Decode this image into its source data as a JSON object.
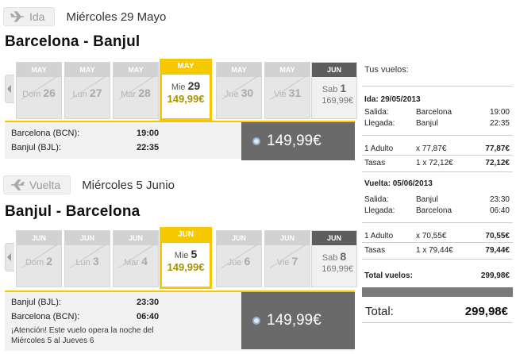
{
  "outbound": {
    "tag": "Ida",
    "date": "Miércoles 29 Mayo",
    "route": "Barcelona - Banjul",
    "days": [
      {
        "month": "MAY",
        "dow": "Dom",
        "num": "26"
      },
      {
        "month": "MAY",
        "dow": "Lun",
        "num": "27"
      },
      {
        "month": "MAY",
        "dow": "Mar",
        "num": "28"
      },
      {
        "month": "MAY",
        "dow": "Mie",
        "num": "29",
        "price": "149,99€"
      },
      {
        "month": "MAY",
        "dow": "Jue",
        "num": "30"
      },
      {
        "month": "MAY",
        "dow": "Vie",
        "num": "31"
      },
      {
        "month": "JUN",
        "dow": "Sab",
        "num": "1",
        "price": "169,99€"
      }
    ],
    "from": "Barcelona (BCN):",
    "from_time": "19:00",
    "to": "Banjul (BJL):",
    "to_time": "22:35",
    "price": "149,99€"
  },
  "return": {
    "tag": "Vuelta",
    "date": "Miércoles 5 Junio",
    "route": "Banjul - Barcelona",
    "days": [
      {
        "month": "JUN",
        "dow": "Dom",
        "num": "2"
      },
      {
        "month": "JUN",
        "dow": "Lun",
        "num": "3"
      },
      {
        "month": "JUN",
        "dow": "Mar",
        "num": "4"
      },
      {
        "month": "JUN",
        "dow": "Mie",
        "num": "5",
        "price": "149,99€"
      },
      {
        "month": "JUN",
        "dow": "Jue",
        "num": "6"
      },
      {
        "month": "JUN",
        "dow": "Vie",
        "num": "7"
      },
      {
        "month": "JUN",
        "dow": "Sab",
        "num": "8",
        "price": "169,99€"
      }
    ],
    "from": "Banjul (BJL):",
    "from_time": "23:30",
    "to": "Barcelona (BCN):",
    "to_time": "06:40",
    "note": "¡Atención! Este vuelo opera la noche del Miércoles 5 al Jueves 6",
    "price": "149,99€"
  },
  "summary": {
    "title": "Tus vuelos:",
    "outbound": {
      "header": "Ida: 29/05/2013",
      "dep_label": "Salida:",
      "dep_city": "Barcelona",
      "dep_time": "19:00",
      "arr_label": "Llegada:",
      "arr_city": "Banjul",
      "arr_time": "22:35",
      "adult_label": "1 Adulto",
      "adult_mult": "x 77,87€",
      "adult_total": "77,87€",
      "tax_label": "Tasas",
      "tax_mult": "1 x 72,12€",
      "tax_total": "72,12€"
    },
    "return": {
      "header": "Vuelta: 05/06/2013",
      "dep_label": "Salida:",
      "dep_city": "Banjul",
      "dep_time": "23:30",
      "arr_label": "Llegada:",
      "arr_city": "Barcelona",
      "arr_time": "06:40",
      "adult_label": "1 Adulto",
      "adult_mult": "x 70,55€",
      "adult_total": "70,55€",
      "tax_label": "Tasas",
      "tax_mult": "1 x 79,44€",
      "tax_total": "79,44€"
    },
    "total_flights_label": "Total vuelos:",
    "total_flights": "299,98€",
    "total_label": "Total:",
    "total": "299,98€"
  },
  "colors": {
    "accent": "#f5c800",
    "price_text": "#a89200",
    "dark_box": "#6a6a6a"
  },
  "icons": {
    "trip_tag": "airplane-icon",
    "nav": "chevron-left-icon",
    "radio": "radio-selected-icon"
  }
}
